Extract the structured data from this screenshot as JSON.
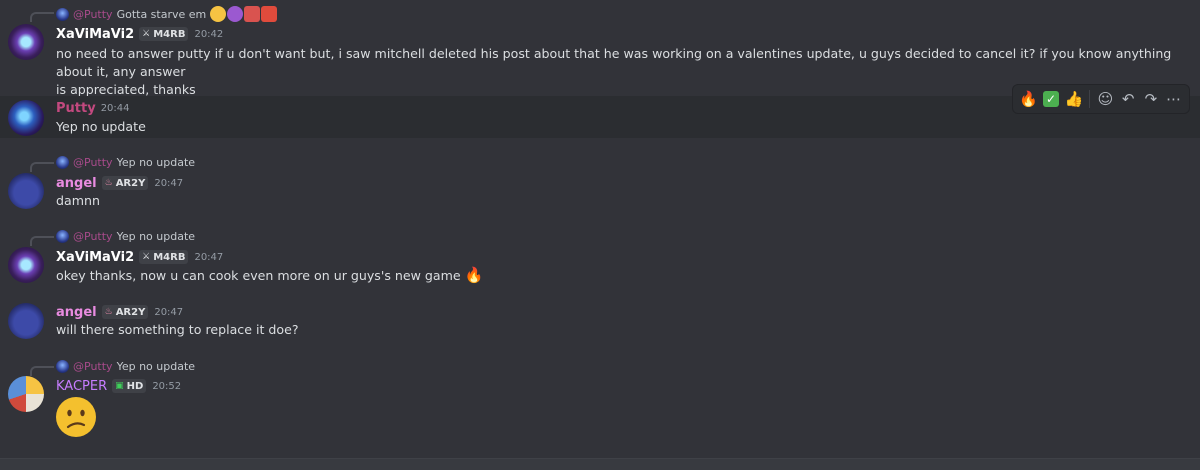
{
  "messages": [
    {
      "reply": {
        "mention": "@Putty",
        "text": "Gotta starve em"
      },
      "author": "XaViMaVi2",
      "author_color": "#ffffff",
      "tag": "M4RB",
      "time": "20:42",
      "lines": [
        "no need to answer putty if u don't want but, i saw mitchell deleted his post about that he was working on a valentines update, u guys decided to cancel it? if you know anything about it, any answer",
        "is appreciated, thanks"
      ]
    },
    {
      "author": "Putty",
      "author_color": "#c3497f",
      "time": "20:44",
      "text": "Yep no update"
    },
    {
      "reply": {
        "mention": "@Putty",
        "text": "Yep no update"
      },
      "author": "angel",
      "author_color": "#e88be0",
      "tag": "AR2Y",
      "time": "20:47",
      "text": "damnn"
    },
    {
      "reply": {
        "mention": "@Putty",
        "text": "Yep no update"
      },
      "author": "XaViMaVi2",
      "author_color": "#ffffff",
      "tag": "M4RB",
      "time": "20:47",
      "text": "okey thanks, now u can cook even more on ur guys's new game"
    },
    {
      "author": "angel",
      "author_color": "#e88be0",
      "tag": "AR2Y",
      "time": "20:47",
      "text": "will there something to replace it doe?"
    },
    {
      "reply": {
        "mention": "@Putty",
        "text": "Yep no update"
      },
      "author": "KACPER",
      "author_color": "#c77dff",
      "tag": "HD",
      "time": "20:52"
    }
  ],
  "toolbar": {
    "reactions": [
      "fire-emoji",
      "check-emoji",
      "thumbs-up-emoji"
    ],
    "actions": [
      "add-reaction-icon",
      "reply-icon",
      "forward-icon",
      "more-icon"
    ]
  }
}
